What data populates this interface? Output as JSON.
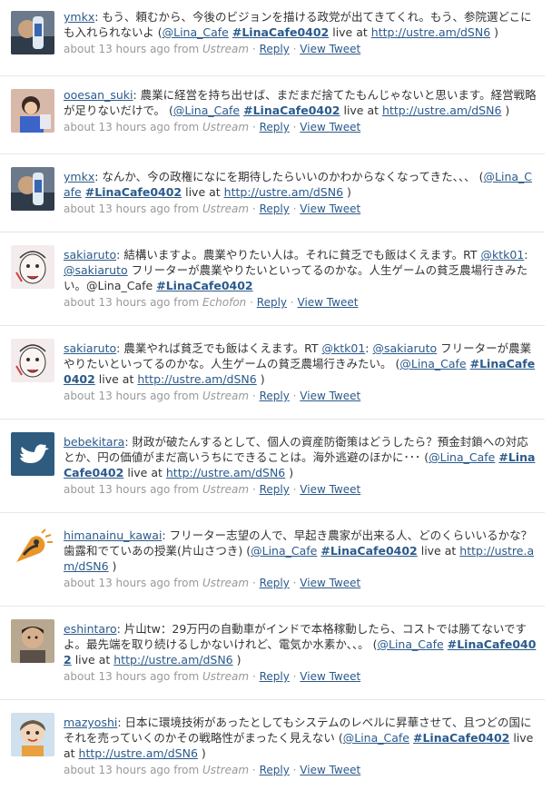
{
  "tweets": [
    {
      "user": "ymkx",
      "avatar": "photo-avatar-bottle",
      "text": "もう、頼むから、今後のビジョンを描ける政党が出てきてくれ。もう、参院選どこにも入れられないよ",
      "mention": "@Lina_Cafe",
      "hashtag": "#LinaCafe0402",
      "live_at": "live at",
      "url": "http://ustre.am/dSN6",
      "tail": " )",
      "time": "about 13 hours ago",
      "from": "from",
      "source": "Ustream",
      "reply": "Reply",
      "view": "View Tweet"
    },
    {
      "user": "ooesan_suki",
      "avatar": "photo-avatar-girl",
      "text": "農業に経営を持ち出せば、まだまだ捨てたもんじゃないと思います。経営戦略が足りないだけで。",
      "mention": "@Lina_Cafe",
      "hashtag": "#LinaCafe0402",
      "live_at": "live at",
      "url": "http://ustre.am/dSN6",
      "tail": " )",
      "time": "about 13 hours ago",
      "from": "from",
      "source": "Ustream",
      "reply": "Reply",
      "view": "View Tweet"
    },
    {
      "user": "ymkx",
      "avatar": "photo-avatar-bottle",
      "text": "なんか、今の政権になにを期待したらいいのかわからなくなってきた、、、",
      "mention": "@Lina_Cafe",
      "hashtag": "#LinaCafe0402",
      "live_at": "live at",
      "url": "http://ustre.am/dSN6",
      "tail": " )",
      "time": "about 13 hours ago",
      "from": "from",
      "source": "Ustream",
      "reply": "Reply",
      "view": "View Tweet"
    },
    {
      "user": "sakiaruto",
      "avatar": "sketch-avatar-face",
      "text": "結構いますよ。農業やりたい人は。それに貧乏でも飯はくえます。RT ",
      "rt_user": "@ktk01",
      "rt_sep": ": ",
      "rt_mention": "@sakiaruto",
      "rt_text": " フリーターが農業やりたいといってるのかな。人生ゲームの貧乏農場行きみたい。@Lina_Cafe ",
      "hashtag": "#LinaCafe0402",
      "time": "about 13 hours ago",
      "from": "from",
      "source": "Echofon",
      "reply": "Reply",
      "view": "View Tweet"
    },
    {
      "user": "sakiaruto",
      "avatar": "sketch-avatar-face",
      "text": "農業やれば貧乏でも飯はくえます。RT ",
      "rt_user": "@ktk01",
      "rt_sep": ": ",
      "rt_mention": "@sakiaruto",
      "rt_text": " フリーターが農業やりたいといってるのかな。人生ゲームの貧乏農場行きみたい。",
      "mention": "@Lina_Cafe",
      "hashtag": "#LinaCafe0402",
      "live_at": "live at",
      "url": "http://ustre.am/dSN6",
      "tail": " )",
      "time": "about 13 hours ago",
      "from": "from",
      "source": "Ustream",
      "reply": "Reply",
      "view": "View Tweet"
    },
    {
      "user": "bebekitara",
      "avatar": "twitter-bird-avatar",
      "text": "財政が破たんするとして、個人の資産防衛策はどうしたら？預金封鎖への対応とか、円の価値がまだ高いうちにできることは。海外逃避のほかに･･･",
      "mention": "@Lina_Cafe",
      "hashtag": "#LinaCafe0402",
      "live_at": "live at",
      "url": "http://ustre.am/dSN6",
      "tail": " )",
      "time": "about 13 hours ago",
      "from": "from",
      "source": "Ustream",
      "reply": "Reply",
      "view": "View Tweet"
    },
    {
      "user": "himanainu_kawai",
      "avatar": "orange-shape-avatar",
      "text": "フリーター志望の人で、早起き農家が出来る人、どのくらいいるかな？歯露和でていあの授業(片山さつき)",
      "mention": "@Lina_Cafe",
      "hashtag": "#LinaCafe0402",
      "live_at": "live at",
      "url": "http://ustre.am/dSN6",
      "tail": " )",
      "time": "about 13 hours ago",
      "from": "from",
      "source": "Ustream",
      "reply": "Reply",
      "view": "View Tweet"
    },
    {
      "user": "eshintaro",
      "avatar": "photo-avatar-man",
      "text": "片山tw：29万円の自動車がインドで本格稼動したら、コストでは勝てないですよ。最先端を取り続けるしかないけれど、電気か水素か、、。",
      "mention": "@Lina_Cafe",
      "hashtag": "#LinaCafe0402",
      "live_at": "live at",
      "url": "http://ustre.am/dSN6",
      "tail": " )",
      "time": "about 13 hours ago",
      "from": "from",
      "source": "Ustream",
      "reply": "Reply",
      "view": "View Tweet"
    },
    {
      "user": "mazyoshi",
      "avatar": "cartoon-avatar-woman",
      "text": "日本に環境技術があったとしてもシステムのレベルに昇華させて、且つどの国にそれを売っていくのかその戦略性がまったく見えない",
      "mention": "@Lina_Cafe",
      "hashtag": "#LinaCafe0402",
      "live_at": "live at",
      "url": "http://ustre.am/dSN6",
      "tail": " )",
      "time": "about 13 hours ago",
      "from": "from",
      "source": "Ustream",
      "reply": "Reply",
      "view": "View Tweet"
    }
  ]
}
